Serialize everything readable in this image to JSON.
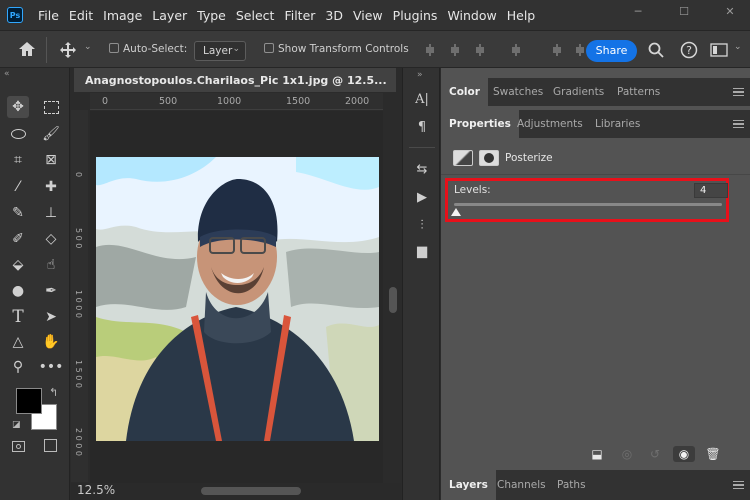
{
  "menubar": {
    "logo": "Ps",
    "items": [
      "File",
      "Edit",
      "Image",
      "Layer",
      "Type",
      "Select",
      "Filter",
      "3D",
      "View",
      "Plugins",
      "Window",
      "Help"
    ]
  },
  "options_bar": {
    "auto_select_label": "Auto-Select:",
    "auto_select_checked": false,
    "layer_select_value": "Layer",
    "show_transform_label": "Show Transform Controls",
    "show_transform_checked": false,
    "share_label": "Share"
  },
  "document": {
    "tab_title": "Anagnostopoulos.Charilaos_Pic 1x1.jpg @ 12.5...",
    "ruler_h_ticks": [
      "0",
      "500",
      "1000",
      "1500",
      "2000"
    ],
    "ruler_v_ticks": [
      "0",
      "5 0 0",
      "1 0 0 0",
      "1 5 0 0",
      "2 0 0 0"
    ],
    "zoom": "12.5%"
  },
  "panel_group_top": {
    "tabs": [
      "Color",
      "Swatches",
      "Gradients",
      "Patterns"
    ],
    "active": "Color"
  },
  "properties_panel": {
    "tabs": [
      "Properties",
      "Adjustments",
      "Libraries"
    ],
    "active": "Properties",
    "adjustment_name": "Posterize",
    "levels_label": "Levels:",
    "levels_value": "4",
    "levels_min": 2,
    "levels_max": 255,
    "highlight_color": "#e8101a"
  },
  "panel_group_bottom": {
    "tabs": [
      "Layers",
      "Channels",
      "Paths"
    ],
    "active": "Layers"
  },
  "colors": {
    "foreground": "#000000",
    "background": "#ffffff",
    "share_button": "#1473e6"
  }
}
